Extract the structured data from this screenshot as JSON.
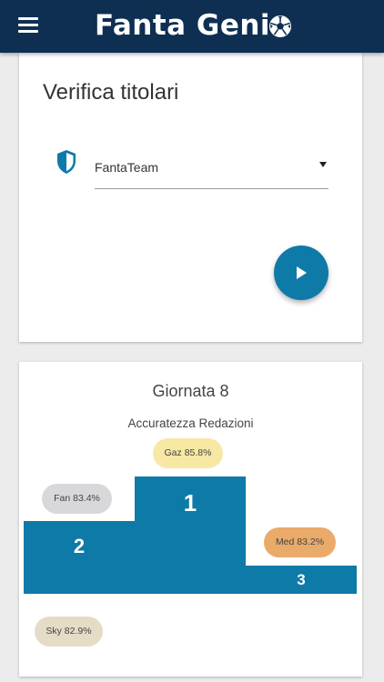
{
  "app": {
    "brand": "Fanta Geni"
  },
  "lineup_card": {
    "title": "Verifica titolari",
    "selected_team": "FantaTeam"
  },
  "ranking_card": {
    "round_title": "Giornata 8",
    "subtitle": "Accuratezza Redazioni",
    "podium": [
      {
        "place": "1",
        "pill": "Gaz 85.8%",
        "accuracy_pct": 85.8
      },
      {
        "place": "2",
        "pill": "Fan 83.4%",
        "accuracy_pct": 83.4
      },
      {
        "place": "3",
        "pill": "Med 83.2%",
        "accuracy_pct": 83.2
      }
    ],
    "others": [
      {
        "pill": "Sky 82.9%",
        "accuracy_pct": 82.9
      }
    ]
  },
  "colors": {
    "appbar": "#0e2f52",
    "accent": "#0e7aa8",
    "gold": "#f7e8a4",
    "silver": "#d8d8db",
    "bronze": "#e9aa6a",
    "other": "#e5dcc7"
  }
}
